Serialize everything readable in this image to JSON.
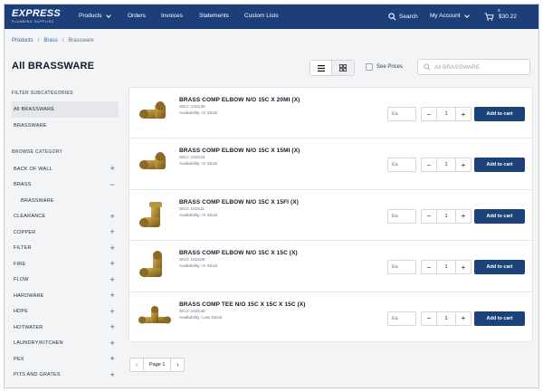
{
  "header": {
    "logo_main": "EXPRESS",
    "logo_sub": "PLUMBING SUPPLIES",
    "nav": [
      "Products",
      "Orders",
      "Invoices",
      "Statements",
      "Custom Lists"
    ],
    "search_label": "Search",
    "account_label": "My Account",
    "cart_count": "3",
    "cart_total": "$30.22"
  },
  "breadcrumb": [
    "Products",
    "Brass",
    "Brassware"
  ],
  "page_title": "All BRASSWARE",
  "see_prices_label": "See Prices",
  "search_placeholder": "All BRASSWARE",
  "sidebar": {
    "filter_heading": "FILTER SUBCATEGORIES",
    "filter_items": [
      "All BRASSWARE",
      "BRASSWARE"
    ],
    "browse_heading": "BROWSE CATEGORY",
    "categories": [
      {
        "label": "BACK OF WALL",
        "toggle": "+"
      },
      {
        "label": "BRASS",
        "toggle": "−"
      },
      {
        "label": "BRASSWARE",
        "toggle": ""
      },
      {
        "label": "CLEARANCE",
        "toggle": "+"
      },
      {
        "label": "COPPER",
        "toggle": "+"
      },
      {
        "label": "FILTER",
        "toggle": "+"
      },
      {
        "label": "FIRE",
        "toggle": "+"
      },
      {
        "label": "FLOW",
        "toggle": "+"
      },
      {
        "label": "HARDWARE",
        "toggle": "+"
      },
      {
        "label": "HDPE",
        "toggle": "+"
      },
      {
        "label": "HOTWATER",
        "toggle": "+"
      },
      {
        "label": "LAUNDRY/KITCHEN",
        "toggle": "+"
      },
      {
        "label": "PEX",
        "toggle": "+"
      },
      {
        "label": "PITS AND GRATES",
        "toggle": "+"
      }
    ]
  },
  "products": [
    {
      "name": "BRASS COMP ELBOW N/O 15C X 20MI (X)",
      "sku": "SKU: 102130",
      "availability": "Availability: In Stock",
      "uom": "Ea",
      "qty": "1",
      "add_label": "Add to cart"
    },
    {
      "name": "BRASS COMP ELBOW N/O 15C X 15MI (X)",
      "sku": "SKU: 102124",
      "availability": "Availability: In Stock",
      "uom": "Ea",
      "qty": "1",
      "add_label": "Add to cart"
    },
    {
      "name": "BRASS COMP ELBOW N/O 15C X 15FI (X)",
      "sku": "SKU: 102111",
      "availability": "Availability: In Stock",
      "uom": "Ea",
      "qty": "1",
      "add_label": "Add to cart"
    },
    {
      "name": "BRASS COMP ELBOW N/O 15C X 15C (X)",
      "sku": "SKU: 102105",
      "availability": "Availability: In Stock",
      "uom": "Ea",
      "qty": "1",
      "add_label": "Add to cart"
    },
    {
      "name": "BRASS COMP TEE N/O 15C X 15C X 15C (X)",
      "sku": "SKU: 102140",
      "availability": "Availability: Low Stock",
      "uom": "Ea",
      "qty": "1",
      "add_label": "Add to cart"
    }
  ],
  "pagination": {
    "label": "Page 1",
    "prev": "‹",
    "next": "›"
  },
  "colors": {
    "header": "#1c3f7a",
    "primary_button": "#1b4279",
    "link": "#2a5ea8"
  }
}
